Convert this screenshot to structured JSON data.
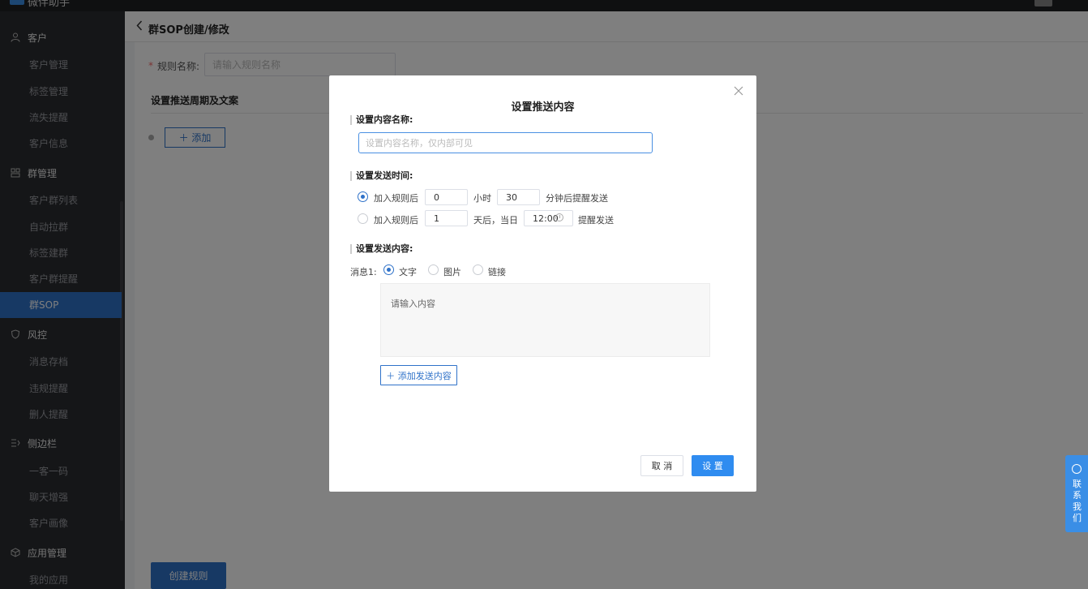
{
  "topbar": {
    "app_name": "微伴助手"
  },
  "sidebar": {
    "groups": [
      {
        "label": "客户",
        "icon": "user-icon",
        "items": [
          "客户管理",
          "标签管理",
          "流失提醒",
          "客户信息"
        ]
      },
      {
        "label": "群管理",
        "icon": "group-icon",
        "items": [
          "客户群列表",
          "自动拉群",
          "标签建群",
          "客户群提醒",
          "群SOP"
        ]
      },
      {
        "label": "风控",
        "icon": "shield-icon",
        "items": [
          "消息存档",
          "违规提醒",
          "删人提醒"
        ]
      },
      {
        "label": "侧边栏",
        "icon": "sidebar-icon",
        "items": [
          "一客一码",
          "聊天增强",
          "客户画像"
        ]
      },
      {
        "label": "应用管理",
        "icon": "box-icon",
        "items": [
          "我的应用"
        ]
      }
    ],
    "active_item": "群SOP"
  },
  "page": {
    "title": "群SOP创建/修改",
    "rule_name_label": "规则名称:",
    "rule_name_placeholder": "请输入规则名称",
    "section_title": "设置推送周期及文案",
    "add_label": "＋ 添加",
    "create_button": "创建规则"
  },
  "modal": {
    "title": "设置推送内容",
    "name_label": "设置内容名称:",
    "name_placeholder": "设置内容名称，仅内部可见",
    "time_label": "设置发送时间:",
    "option1": {
      "prefix": "加入规则后",
      "hours": "0",
      "hours_unit": "小时",
      "minutes": "30",
      "suffix": "分钟后提醒发送",
      "selected": true
    },
    "option2": {
      "prefix": "加入规则后",
      "days": "1",
      "days_unit": "天后，当日",
      "time": "12:00",
      "suffix": "提醒发送",
      "selected": false
    },
    "content_label": "设置发送内容:",
    "message_label": "消息1:",
    "message_types": [
      {
        "label": "文字",
        "selected": true
      },
      {
        "label": "图片",
        "selected": false
      },
      {
        "label": "链接",
        "selected": false
      }
    ],
    "content_placeholder": "请输入内容",
    "add_content_button": "＋ 添加发送内容",
    "cancel_button": "取 消",
    "confirm_button": "设 置"
  },
  "contact_float": {
    "label": "联系我们"
  },
  "colors": {
    "accent": "#2f72c9",
    "sidebar_bg": "#2b2c30",
    "active_bg": "#2f72c9",
    "overlay": "rgba(0,0,0,0.5)"
  }
}
